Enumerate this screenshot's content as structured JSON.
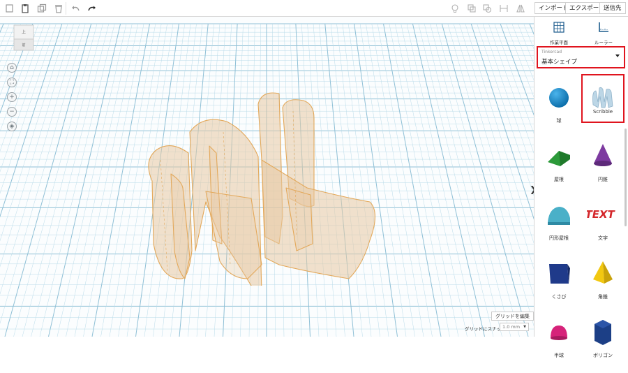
{
  "toolbar": {
    "import_label": "インポート",
    "export_label": "エクスポート",
    "send_label": "送信先"
  },
  "viewcube": {
    "top_label": "上",
    "front_label": "前"
  },
  "grid": {
    "edit_label": "グリッドを編集",
    "snap_label": "グリッドにスナップ",
    "snap_value": "1.0 mm"
  },
  "panel": {
    "workplane_label": "作業平面",
    "ruler_label": "ルーラー",
    "library": {
      "source": "Tinkercad",
      "category": "基本シェイプ"
    },
    "shapes": [
      {
        "label": "球",
        "icon": "sphere-icon",
        "color": "#1e8fd0"
      },
      {
        "label": "Scribble",
        "icon": "scribble-icon",
        "color": "#a6c4d8",
        "selected": true
      },
      {
        "label": "屋根",
        "icon": "roof-icon",
        "color": "#2c9a3a"
      },
      {
        "label": "円錐",
        "icon": "cone-icon",
        "color": "#7d3aa0"
      },
      {
        "label": "円形屋根",
        "icon": "round-roof-icon",
        "color": "#4ab0c8"
      },
      {
        "label": "文字",
        "icon": "text-icon",
        "color": "#d4262a"
      },
      {
        "label": "くさび",
        "icon": "wedge-icon",
        "color": "#1f3a8a"
      },
      {
        "label": "角錐",
        "icon": "pyramid-icon",
        "color": "#f2c811"
      },
      {
        "label": "半球",
        "icon": "half-sphere-icon",
        "color": "#d6237a"
      },
      {
        "label": "ポリゴン",
        "icon": "polygon-icon",
        "color": "#1c3f86"
      }
    ],
    "text_shape_text": "TEXT"
  },
  "colors": {
    "accent_red": "#e0141e",
    "grid_line": "#a9cfe0",
    "shape_stroke": "#e3a85a"
  }
}
